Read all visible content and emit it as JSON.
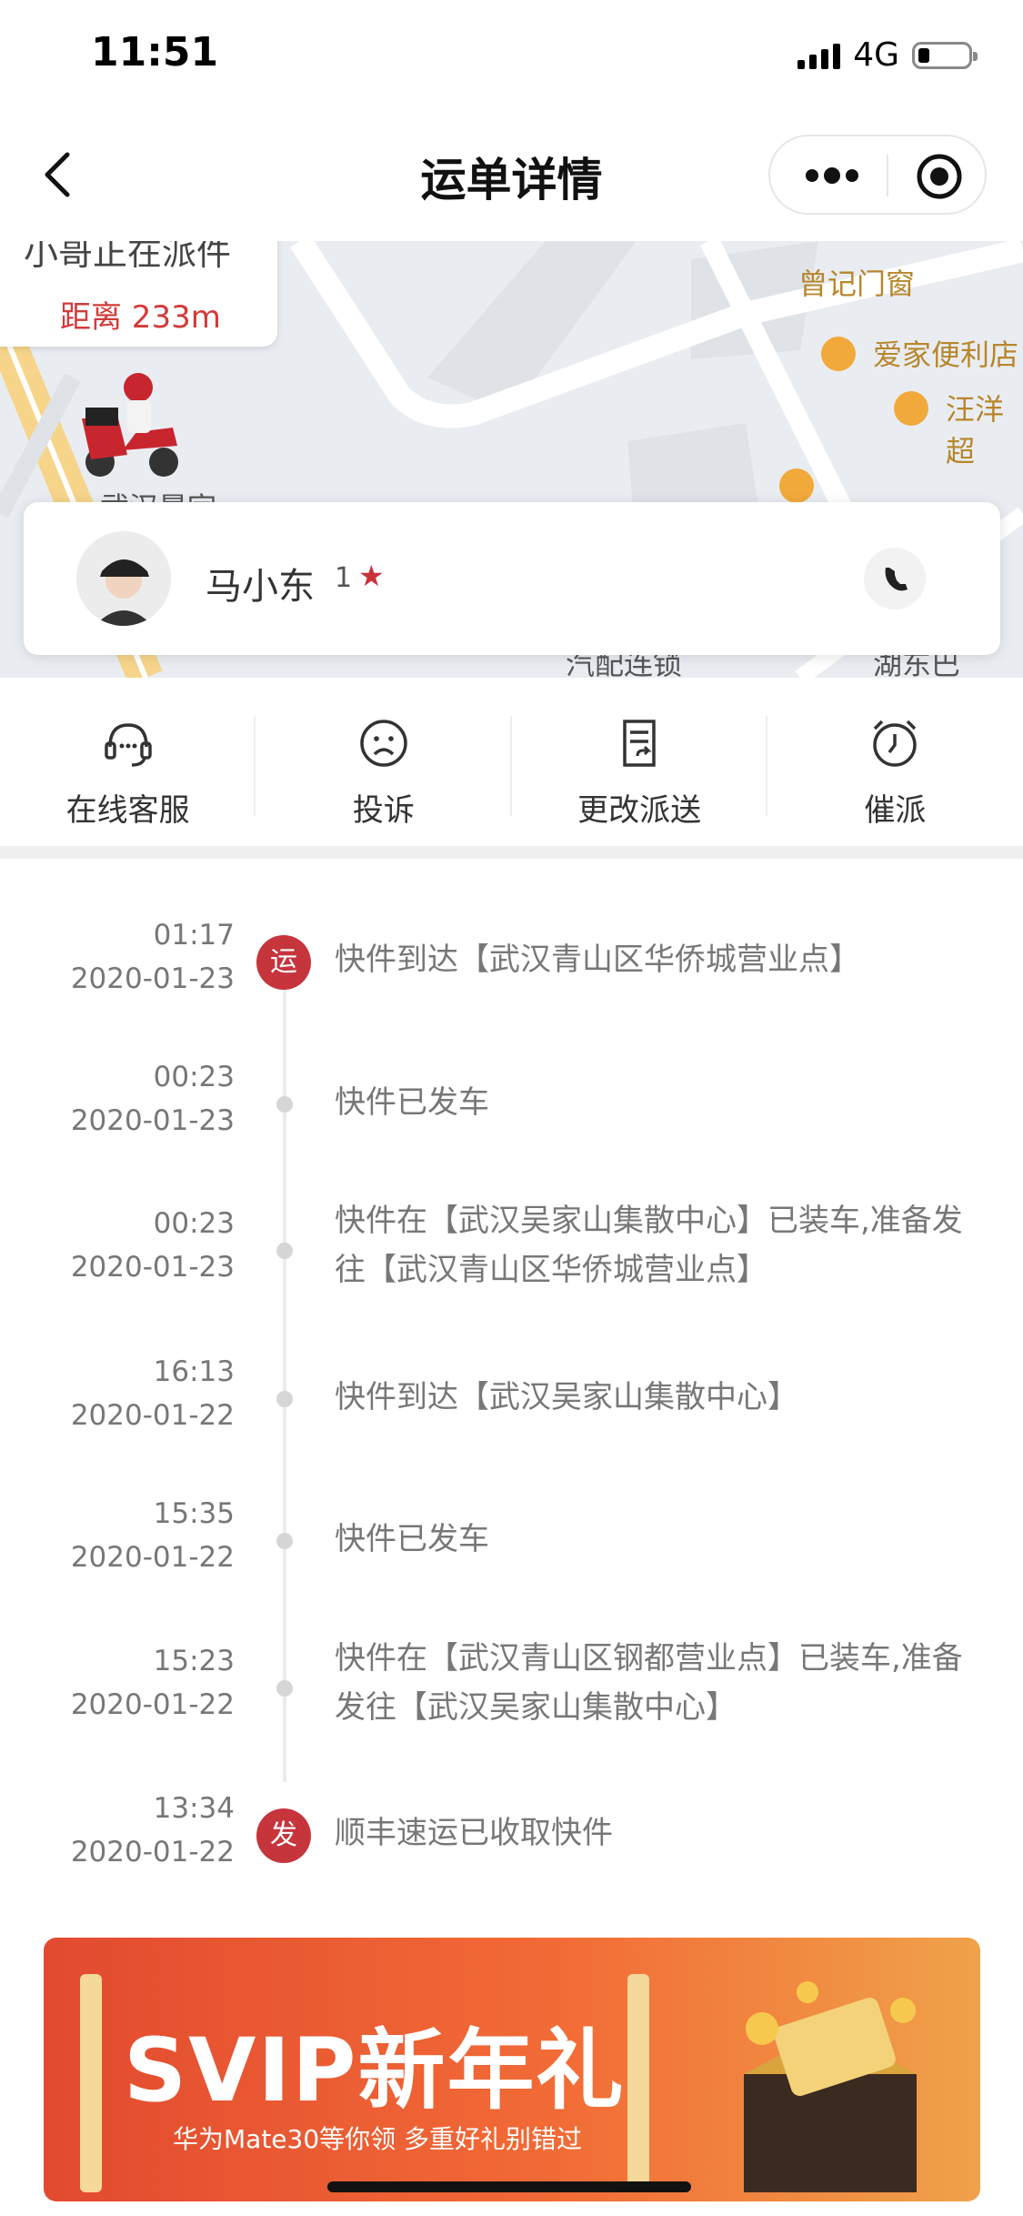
{
  "status": {
    "time": "11:51",
    "network": "4G"
  },
  "nav": {
    "title": "运单详情"
  },
  "map": {
    "tip_title": "小哥正在派件",
    "tip_distance": "距离 233m",
    "labels": [
      "曾记门窗",
      "爱家便利店",
      "汪洋超",
      "武汉晨宇",
      "汽配连锁",
      "湖东巴"
    ]
  },
  "courier": {
    "name": "马小东",
    "rating": "1"
  },
  "actions": [
    {
      "label": "在线客服",
      "icon": "headset-icon"
    },
    {
      "label": "投诉",
      "icon": "sad-face-icon"
    },
    {
      "label": "更改派送",
      "icon": "edit-document-icon"
    },
    {
      "label": "催派",
      "icon": "alarm-clock-icon"
    }
  ],
  "timeline": [
    {
      "time": "01:17",
      "date": "2020-01-23",
      "text": "快件到达【武汉青山区华侨城营业点】",
      "badge": "运"
    },
    {
      "time": "00:23",
      "date": "2020-01-23",
      "text": "快件已发车",
      "badge": ""
    },
    {
      "time": "00:23",
      "date": "2020-01-23",
      "text": "快件在【武汉吴家山集散中心】已装车,准备发往【武汉青山区华侨城营业点】",
      "badge": ""
    },
    {
      "time": "16:13",
      "date": "2020-01-22",
      "text": "快件到达【武汉吴家山集散中心】",
      "badge": ""
    },
    {
      "time": "15:35",
      "date": "2020-01-22",
      "text": "快件已发车",
      "badge": ""
    },
    {
      "time": "15:23",
      "date": "2020-01-22",
      "text": "快件在【武汉青山区钢都营业点】已装车,准备发往【武汉吴家山集散中心】",
      "badge": ""
    },
    {
      "time": "13:34",
      "date": "2020-01-22",
      "text": "顺丰速运已收取快件",
      "badge": "发"
    }
  ],
  "banner": {
    "title": "SVIP新年礼",
    "subtitle": "华为Mate30等你领  多重好礼别错过"
  },
  "colors": {
    "accent": "#c6343c",
    "distance": "#d33a3a"
  }
}
